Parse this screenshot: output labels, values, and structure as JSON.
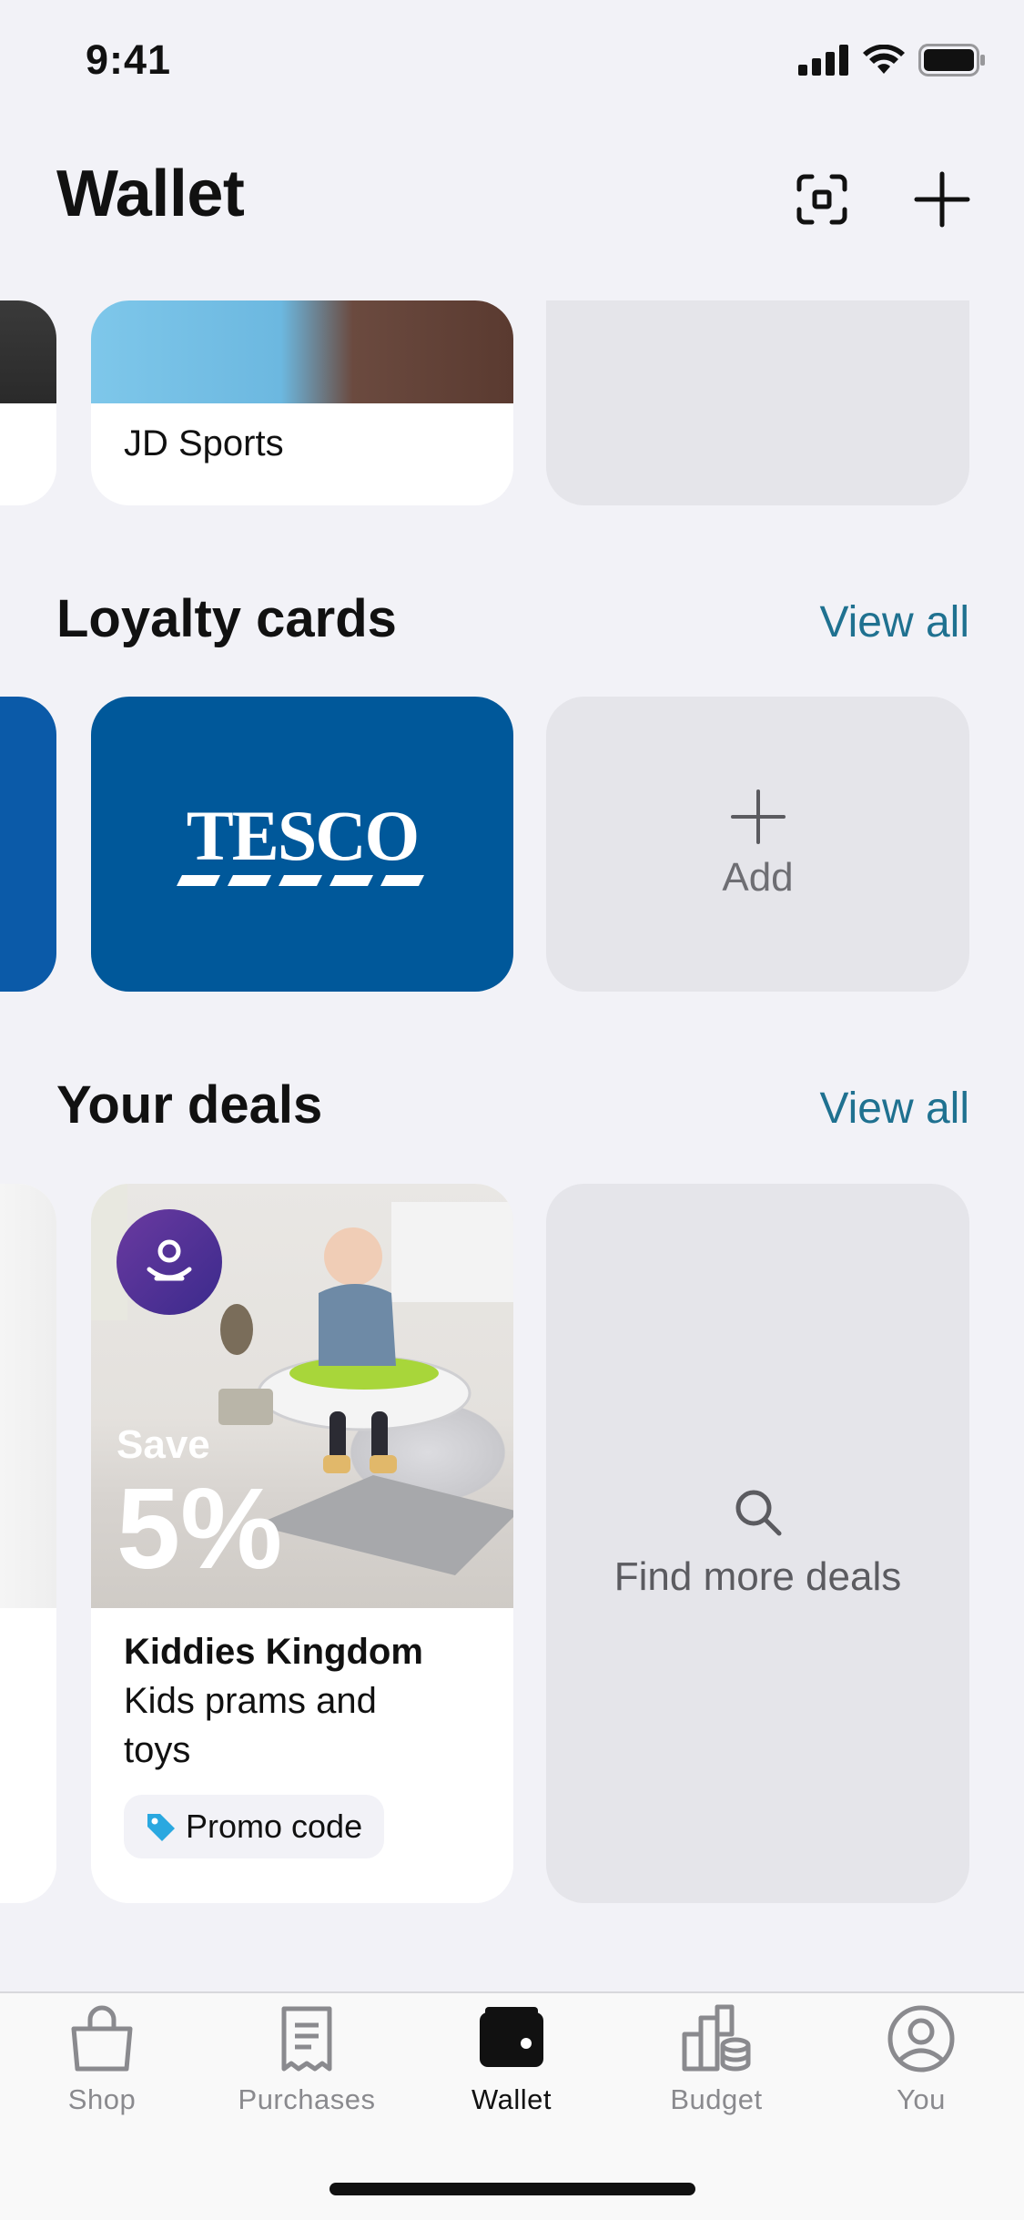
{
  "status_bar": {
    "time": "9:41"
  },
  "header": {
    "title": "Wallet"
  },
  "gift_cards": {
    "items": [
      {
        "name": "JD Sports"
      }
    ]
  },
  "loyalty": {
    "title": "Loyalty cards",
    "view_all": "View all",
    "cards": [
      {
        "brand": "TESCO",
        "color": "#00539f"
      }
    ],
    "add_label": "Add"
  },
  "deals": {
    "title": "Your deals",
    "view_all": "View all",
    "items": [
      {
        "save_label": "Save",
        "percent": "5%",
        "merchant": "Kiddies Kingdom",
        "description": "Kids prams and toys",
        "tag": "Promo code"
      }
    ],
    "find_more": "Find more deals"
  },
  "tabs": [
    {
      "label": "Shop",
      "icon": "shopping-bag-icon"
    },
    {
      "label": "Purchases",
      "icon": "receipt-icon"
    },
    {
      "label": "Wallet",
      "icon": "wallet-icon",
      "active": true
    },
    {
      "label": "Budget",
      "icon": "budget-icon"
    },
    {
      "label": "You",
      "icon": "profile-icon"
    }
  ],
  "colors": {
    "accent": "#1f7190",
    "tesco_blue": "#00539f",
    "background": "#f2f2f7"
  }
}
